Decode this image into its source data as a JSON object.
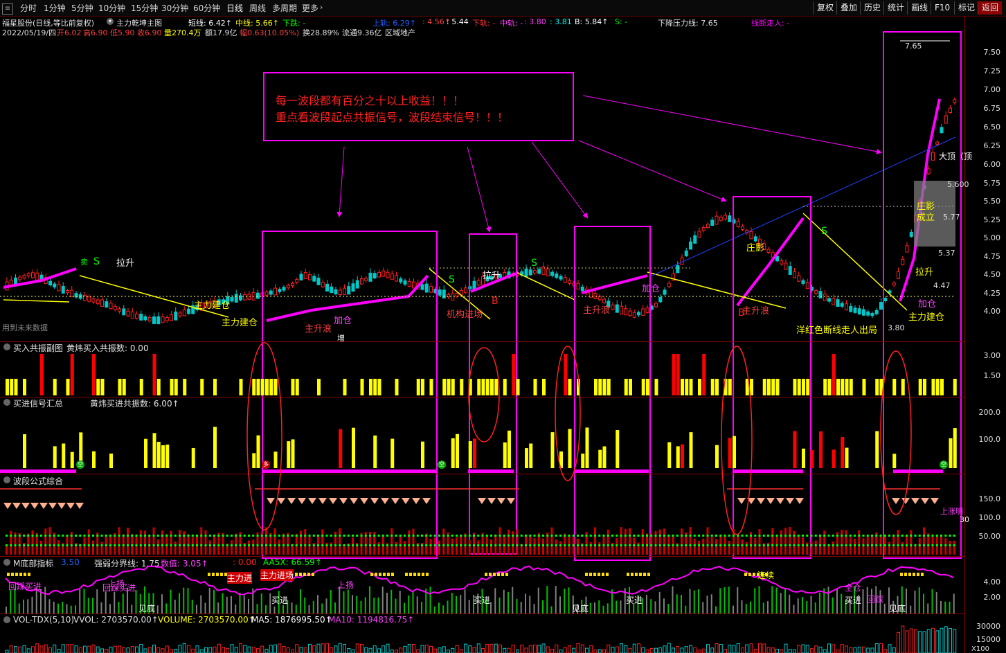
{
  "toolbar": {
    "periods": [
      "分时",
      "1分钟",
      "5分钟",
      "10分钟",
      "15分钟",
      "30分钟",
      "60分钟",
      "日线",
      "周线",
      "多周期",
      "更多"
    ],
    "active": "日线",
    "right_buttons": [
      "复权",
      "叠加",
      "历史",
      "统计",
      "画线",
      "F10",
      "标记",
      "返回"
    ]
  },
  "main": {
    "title": "福星股份(日线,等比前复权)",
    "indicator": "主力乾坤主图",
    "short_line": "短线: 6.42↑",
    "mid_line": "中线: 5.66↑",
    "fall_label": "下跌: -",
    "upper_rail": "上轨: 6.29↑",
    "v1": ": 4.56↑",
    "v2": ": 5.44",
    "lower_rail": "下轨: -",
    "mid_rail": "中轨: -",
    "v3": ": 3.80",
    "v4": ": 3.81",
    "b_val": "B: 5.84↑",
    "s_val": "S: -",
    "pressure": "下降压力线: 7.65",
    "break_line": "线断走人: -",
    "date_row": {
      "date": "2022/05/19/四",
      "open": "开6.02",
      "high": "高6.90",
      "low": "低5.90",
      "close": "收6.90",
      "vol": "量270.4万",
      "amount": "额17.9亿",
      "range": "幅0.63(10.05%)",
      "turnover": "换28.89%",
      "float": "流通9.36亿",
      "sector": "区域地产"
    },
    "y_ticks": [
      "7.50",
      "7.25",
      "7.00",
      "6.75",
      "6.50",
      "6.25",
      "6.00",
      "5.75",
      "5.50",
      "5.25",
      "5.00",
      "4.75",
      "4.50",
      "4.25",
      "4.00"
    ],
    "annotation_line1": "每一波段都有百分之十以上收益！！！",
    "annotation_line2": "重点看波段起点共振信号，波段结束信号！！！",
    "labels": {
      "high_price": "7.65",
      "low_price": "3.80",
      "price_600": "5.600",
      "price_537": "5.37",
      "price_577": "5.77",
      "price_447": "4.47",
      "top_label": "大顶（顶",
      "zhuang_ying": "庄影",
      "cheng_li": "成立",
      "la_sheng": "拉升",
      "zhuli_jiancang": "主力建仓",
      "jigou_jinchang": "机构进场",
      "jiacang": "加仓",
      "zhusheng_lang": "主升浪",
      "exit_note": "洋红色断线走人出局",
      "use_future": "用到未来数据",
      "increase": "增",
      "buy_b": "B",
      "sell_s": "S",
      "mai": "卖"
    }
  },
  "panel1": {
    "title": "买入共振副图",
    "value": "黄炜买入共振数: 0.00",
    "ticks": [
      "3.00",
      "1.50"
    ]
  },
  "panel2": {
    "title": "买进信号汇总",
    "value": "黄炜买进共振数: 6.00↑",
    "ticks": [
      "200.0",
      "100.0"
    ],
    "kong": "空",
    "duo": "多"
  },
  "panel3": {
    "title": "波段公式综合",
    "ticks": [
      "150.0",
      "100.0",
      "50.00"
    ],
    "right_text": "上涨明",
    "right_num": "30"
  },
  "panel4": {
    "title": "M底部指标",
    "v1": "3.50",
    "strong_weak": "强弱分界线: 1.75",
    "value": "数值: 3.05↑",
    "v2": ": 0.00",
    "aa5x": "AA5X: 66.59↑",
    "ticks": [
      "4.00",
      "2.00"
    ],
    "labels": [
      "主力进",
      "主力进场",
      "回踩买进",
      "上扬",
      "回踩买进",
      "见底",
      "买进",
      "上扬",
      "买进",
      "见底",
      "买进",
      "全仓",
      "回踩",
      "连续",
      "见底",
      "买进"
    ]
  },
  "panel5": {
    "title": "VOL-TDX(5,10)",
    "vvol": "VVOL: 2703570.00↑",
    "volume": "VOLUME: 2703570.00↑",
    "ma5": "MA5: 1876995.50↑",
    "ma10": "MA10: 1194816.75↑",
    "ticks": [
      "30000",
      "15000"
    ],
    "unit": "X100"
  },
  "colors": {
    "red": "#ff2020",
    "magenta": "#ff00ff",
    "yellow": "#ffff00",
    "green": "#00ff00",
    "cyan": "#00ffff",
    "axis": "#8b0000"
  }
}
